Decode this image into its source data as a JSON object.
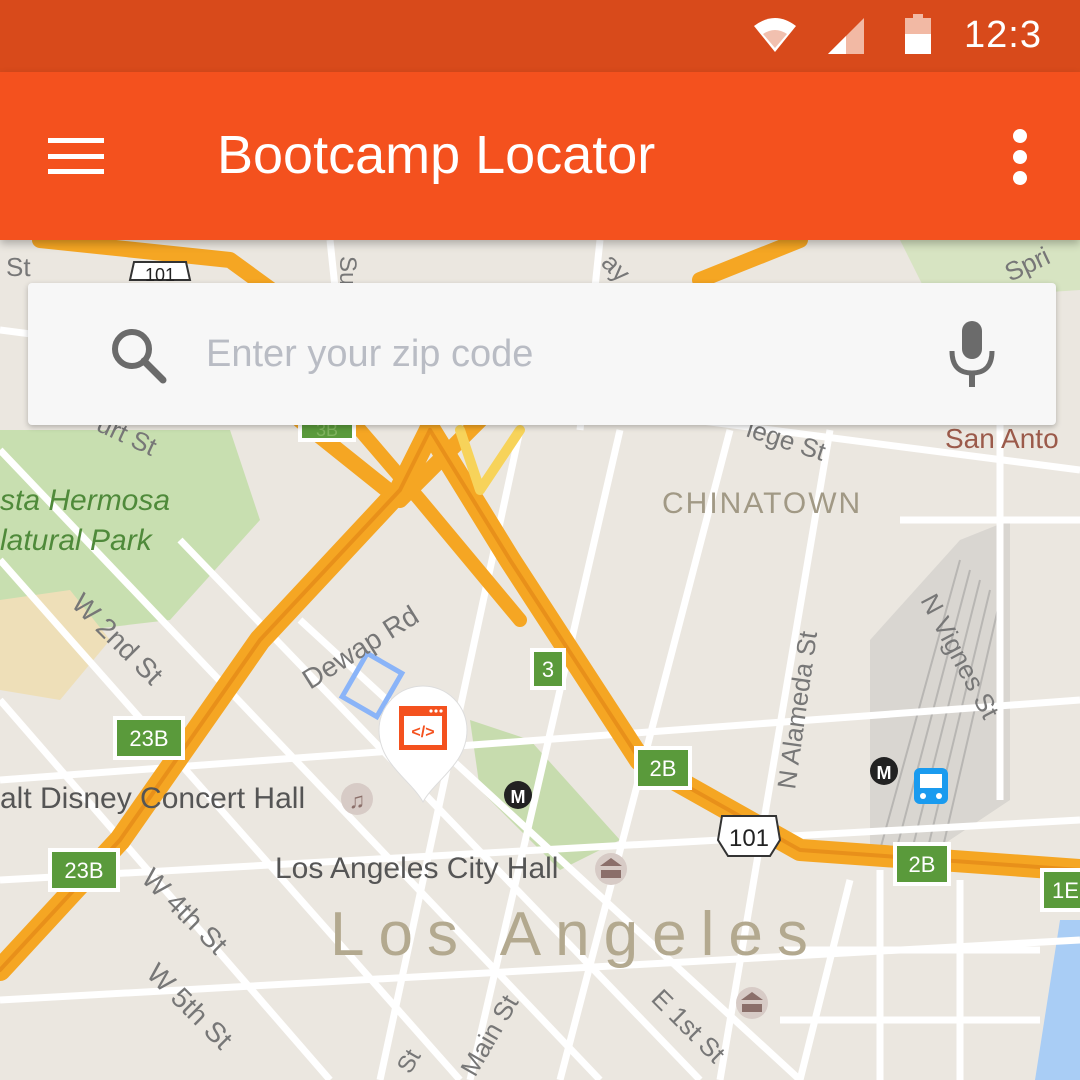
{
  "status_bar": {
    "time": "12:3",
    "icons": [
      "wifi-icon",
      "cell-signal-icon",
      "battery-icon"
    ]
  },
  "app_bar": {
    "title": "Bootcamp Locator",
    "menu_icon": "hamburger-menu-icon",
    "overflow_icon": "more-vert-icon"
  },
  "search": {
    "placeholder": "Enter your zip code",
    "value": "",
    "search_icon": "search-icon",
    "voice_icon": "mic-icon"
  },
  "map": {
    "city_label": "Los Angeles",
    "neighborhood_label": "CHINATOWN",
    "park_label_1": "sta Hermosa",
    "park_label_2": "latural Park",
    "streets": {
      "dewap": "Dewap Rd",
      "w2nd": "W 2nd St",
      "w4th": "W 4th St",
      "w5th": "W 5th St",
      "alameda": "N Alameda St",
      "vignes": "N Vignes St",
      "e1st": "E 1st St",
      "main": "Main St",
      "court": "urt St",
      "college": "lege St",
      "st_top": "St",
      "spring": "Spri",
      "way": "ay",
      "su": "Su",
      "st_bottom": "St",
      "san_antonio": "San Anto"
    },
    "pois": {
      "disney": "alt Disney Concert Hall",
      "city_hall": "Los Angeles City Hall"
    },
    "exits": [
      "3",
      "23B",
      "2B",
      "23B",
      "2B",
      "1E",
      "3B"
    ],
    "highway_shield": "101",
    "highway_shield_top": "101",
    "marker_icon": "code-window-icon",
    "marker_label": "</>",
    "colors": {
      "freeway": "#f5a623",
      "exit_sign": "#5a9a3b",
      "appbar": "#f4511e",
      "statusbar": "#d84a1b"
    }
  }
}
